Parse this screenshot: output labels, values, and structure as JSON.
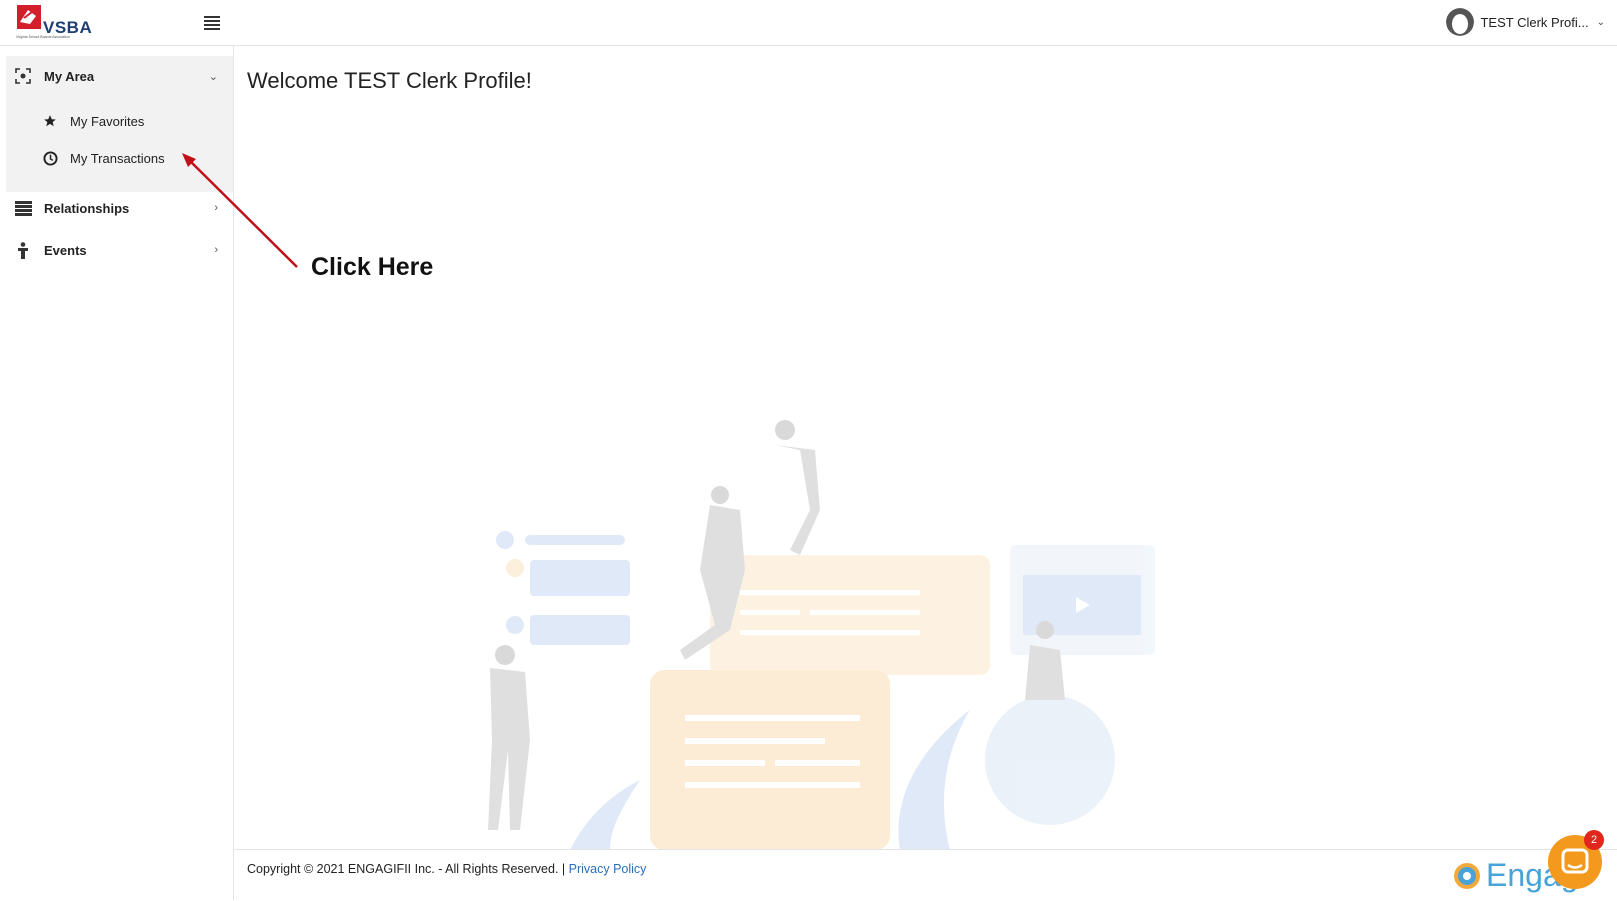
{
  "header": {
    "logo_text": "VSBA",
    "logo_subtext": "Virginia School Boards Association",
    "profile_name": "TEST Clerk Profi..."
  },
  "sidebar": {
    "items": [
      {
        "label": "My Area",
        "icon": "focus-icon",
        "expanded": true,
        "children": [
          {
            "label": "My Favorites",
            "icon": "star-icon"
          },
          {
            "label": "My Transactions",
            "icon": "history-icon"
          }
        ]
      },
      {
        "label": "Relationships",
        "icon": "stack-icon",
        "expanded": false
      },
      {
        "label": "Events",
        "icon": "person-icon",
        "expanded": false
      }
    ]
  },
  "main": {
    "welcome": "Welcome TEST Clerk Profile!",
    "annotation": "Click Here"
  },
  "footer": {
    "copyright": "Copyright © 2021 ENGAGIFII Inc. - All Rights Reserved. |",
    "privacy_link": "Privacy Policy",
    "brand": "Engag"
  },
  "chat": {
    "badge_count": "2"
  },
  "colors": {
    "accent": "#2a6fb7",
    "annotation_arrow": "#c0111b",
    "chat_button": "#f39a1e",
    "badge": "#e0261d"
  }
}
